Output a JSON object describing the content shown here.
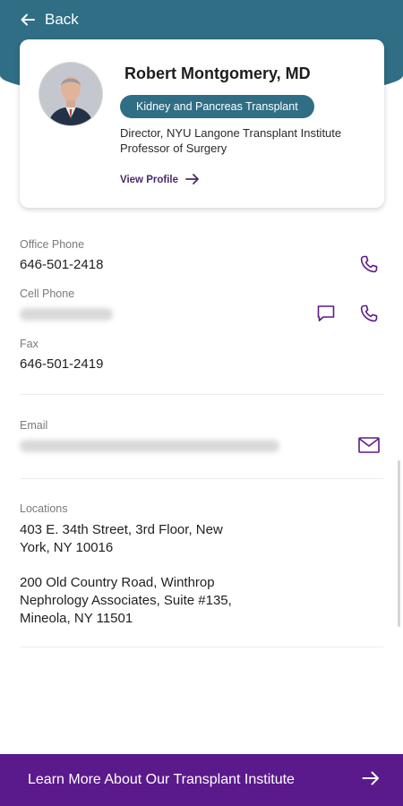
{
  "nav": {
    "back_label": "Back"
  },
  "profile": {
    "name": "Robert Montgomery, MD",
    "specialty": "Kidney and Pancreas Transplant",
    "title_line1": "Director, NYU Langone Transplant Institute",
    "title_line2": "Professor of Surgery",
    "view_profile_label": "View Profile"
  },
  "contact": {
    "office_phone_label": "Office Phone",
    "office_phone": "646-501-2418",
    "cell_phone_label": "Cell Phone",
    "fax_label": "Fax",
    "fax": "646-501-2419",
    "email_label": "Email"
  },
  "locations": {
    "label": "Locations",
    "items": [
      "403 E. 34th Street, 3rd Floor, New York, NY 10016",
      "200 Old Country Road, Winthrop Nephrology Associates, Suite #135, Mineola, NY 11501"
    ]
  },
  "footer": {
    "label": "Learn More About Our Transplant Institute"
  },
  "colors": {
    "header": "#2f6e85",
    "accent_purple": "#5a1a8c",
    "link_purple": "#4b2a6b"
  },
  "icons": [
    "arrow-left-icon",
    "arrow-right-icon",
    "phone-icon",
    "message-icon",
    "mail-icon"
  ]
}
